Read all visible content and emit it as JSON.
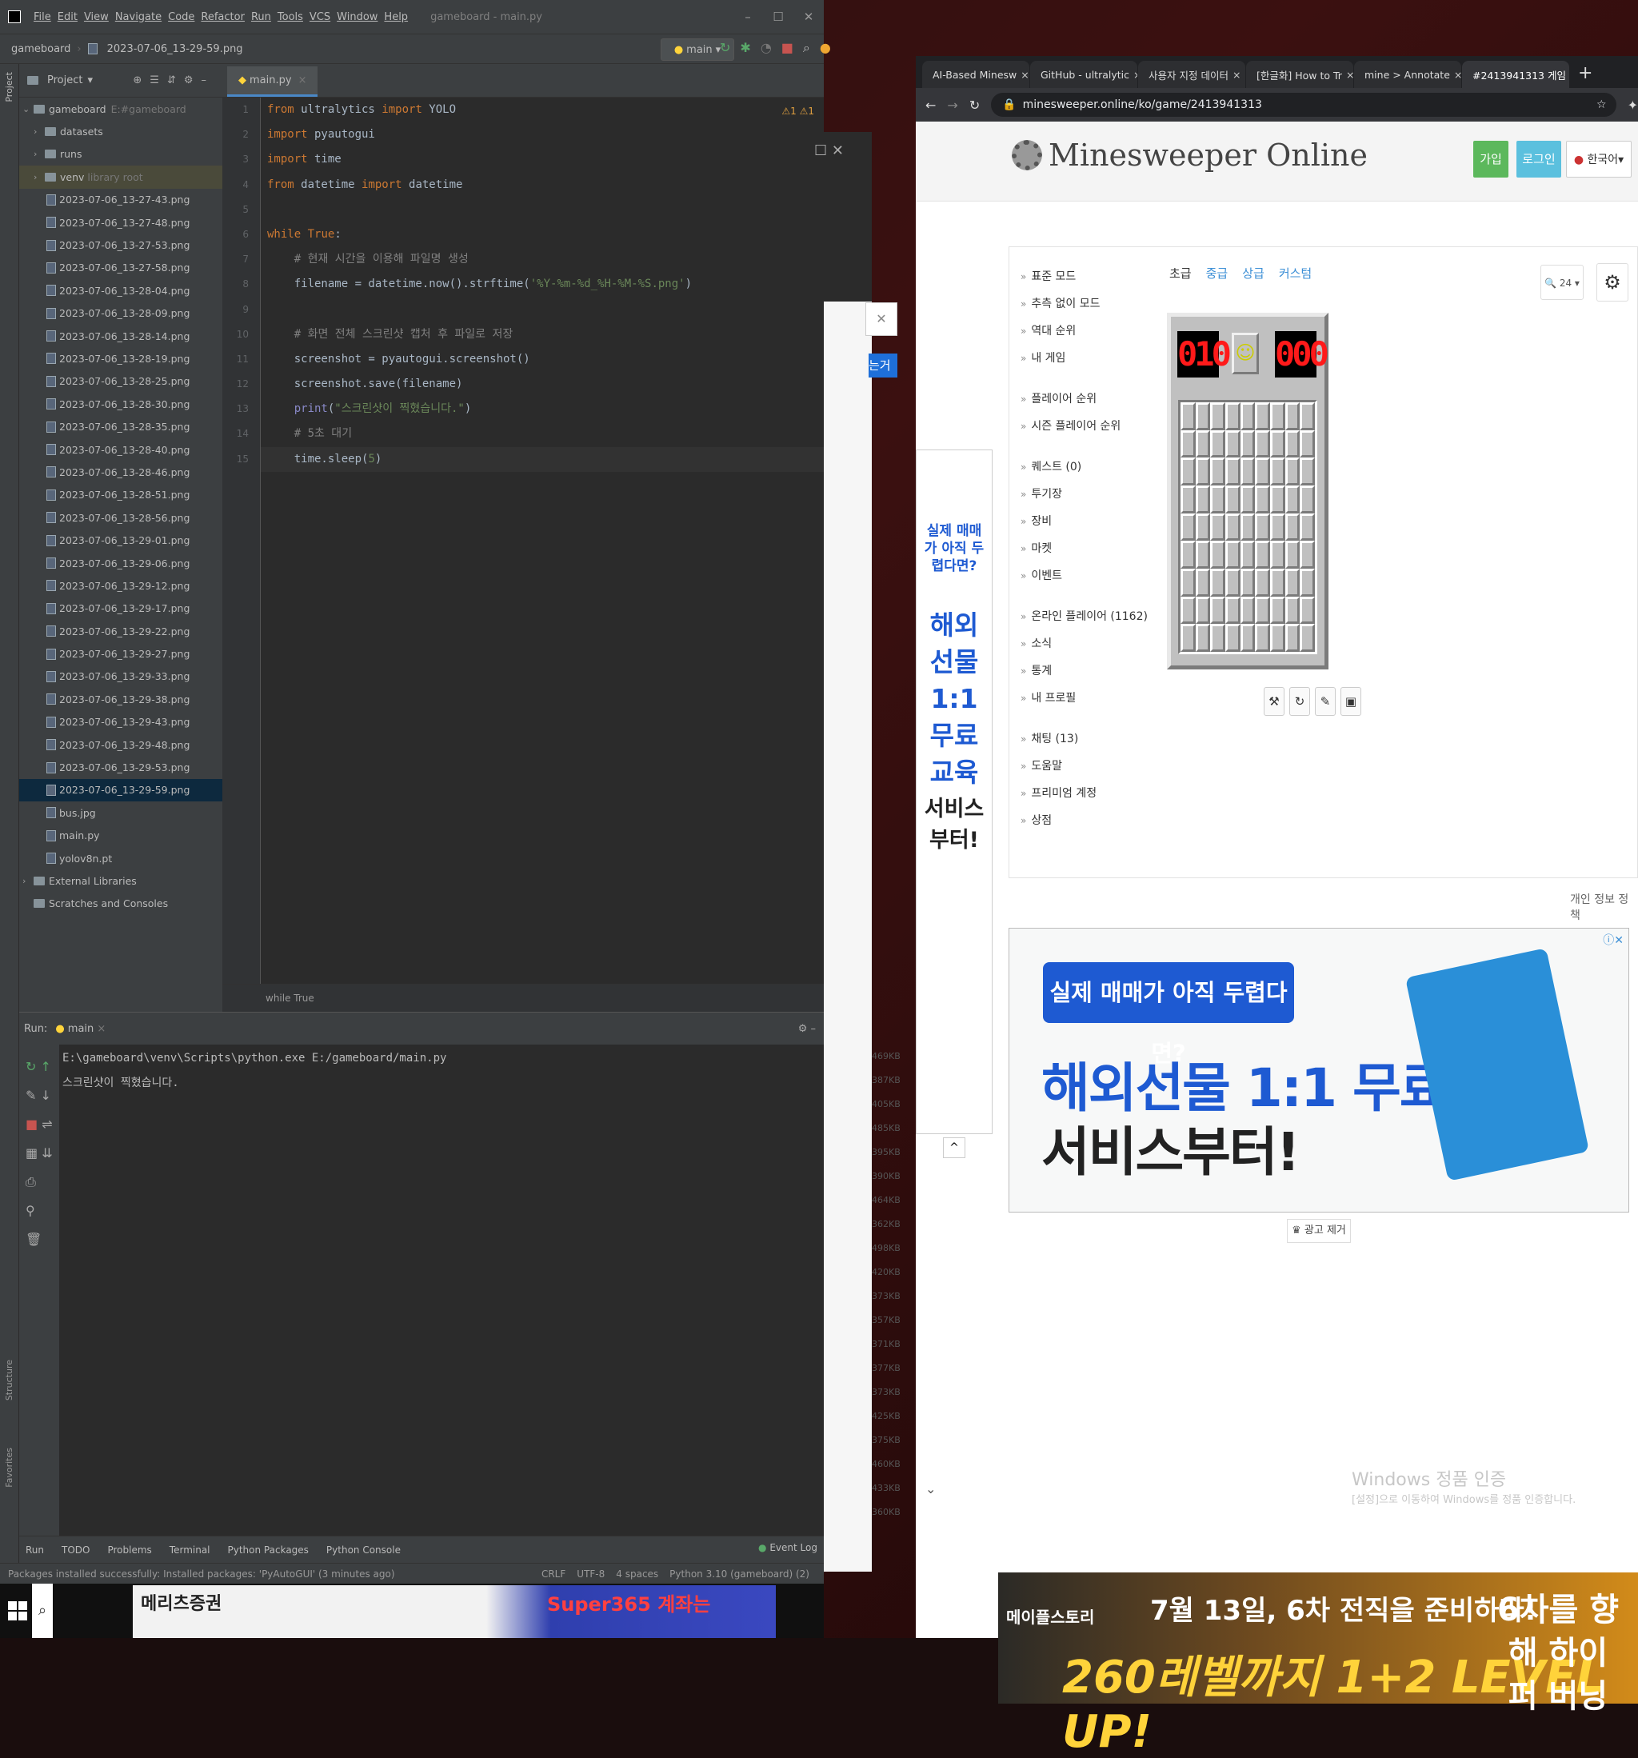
{
  "ide": {
    "menu": [
      "File",
      "Edit",
      "View",
      "Navigate",
      "Code",
      "Refactor",
      "Run",
      "Tools",
      "VCS",
      "Window",
      "Help"
    ],
    "window_title": "gameboard - main.py",
    "breadcrumb_project": "gameboard",
    "breadcrumb_file": "2023-07-06_13-29-59.png",
    "run_config": "main",
    "project_label": "Project",
    "tree_root": "gameboard",
    "tree_root_path": "E:#gameboard",
    "folders": [
      "datasets",
      "runs",
      "venv"
    ],
    "venv_note": "library root",
    "png_files": [
      "2023-07-06_13-27-43.png",
      "2023-07-06_13-27-48.png",
      "2023-07-06_13-27-53.png",
      "2023-07-06_13-27-58.png",
      "2023-07-06_13-28-04.png",
      "2023-07-06_13-28-09.png",
      "2023-07-06_13-28-14.png",
      "2023-07-06_13-28-19.png",
      "2023-07-06_13-28-25.png",
      "2023-07-06_13-28-30.png",
      "2023-07-06_13-28-35.png",
      "2023-07-06_13-28-40.png",
      "2023-07-06_13-28-46.png",
      "2023-07-06_13-28-51.png",
      "2023-07-06_13-28-56.png",
      "2023-07-06_13-29-01.png",
      "2023-07-06_13-29-06.png",
      "2023-07-06_13-29-12.png",
      "2023-07-06_13-29-17.png",
      "2023-07-06_13-29-22.png",
      "2023-07-06_13-29-27.png",
      "2023-07-06_13-29-33.png",
      "2023-07-06_13-29-38.png",
      "2023-07-06_13-29-43.png",
      "2023-07-06_13-29-48.png",
      "2023-07-06_13-29-53.png",
      "2023-07-06_13-29-59.png"
    ],
    "other_files": [
      "bus.jpg",
      "main.py",
      "yolov8n.pt"
    ],
    "external_libraries": "External Libraries",
    "scratches": "Scratches and Consoles",
    "editor_tab": "main.py",
    "inspection": "⚠1 ⚠1",
    "code_lines": [
      [
        {
          "c": "kw",
          "t": "from"
        },
        {
          "c": "",
          "t": " ultralytics "
        },
        {
          "c": "kw",
          "t": "import"
        },
        {
          "c": "",
          "t": " YOLO"
        }
      ],
      [
        {
          "c": "kw",
          "t": "import"
        },
        {
          "c": "",
          "t": " pyautogui"
        }
      ],
      [
        {
          "c": "kw",
          "t": "import"
        },
        {
          "c": "",
          "t": " time"
        }
      ],
      [
        {
          "c": "kw",
          "t": "from"
        },
        {
          "c": "",
          "t": " datetime "
        },
        {
          "c": "kw",
          "t": "import"
        },
        {
          "c": "",
          "t": " datetime"
        }
      ],
      [],
      [
        {
          "c": "kw",
          "t": "while"
        },
        {
          "c": "",
          "t": " "
        },
        {
          "c": "kw",
          "t": "True"
        },
        {
          "c": "",
          "t": ":"
        }
      ],
      [
        {
          "c": "cm",
          "t": "    # 현재 시간을 이용해 파일명 생성"
        }
      ],
      [
        {
          "c": "",
          "t": "    filename = datetime.now().strftime("
        },
        {
          "c": "st",
          "t": "'%Y-%m-%d_%H-%M-%S.png'"
        },
        {
          "c": "",
          "t": ")"
        }
      ],
      [],
      [
        {
          "c": "cm",
          "t": "    # 화면 전체 스크린샷 캡처 후 파일로 저장"
        }
      ],
      [
        {
          "c": "",
          "t": "    screenshot = pyautogui.screenshot()"
        }
      ],
      [
        {
          "c": "",
          "t": "    screenshot.save(filename)"
        }
      ],
      [
        {
          "c": "bi",
          "t": "    print"
        },
        {
          "c": "",
          "t": "("
        },
        {
          "c": "st",
          "t": "\"스크린샷이 찍혔습니다.\""
        },
        {
          "c": "",
          "t": ")"
        }
      ],
      [
        {
          "c": "cm",
          "t": "    # 5초 대기"
        }
      ],
      [
        {
          "c": "",
          "t": "    time.sleep("
        },
        {
          "c": "st",
          "t": "5"
        },
        {
          "c": "",
          "t": ")"
        }
      ]
    ],
    "code_breadcrumb": "while True",
    "run_label": "Run:",
    "run_tab": "main",
    "run_cmd": "E:\\gameboard\\venv\\Scripts\\python.exe E:/gameboard/main.py",
    "run_output": "스크린샷이 찍혔습니다.",
    "bottom_tabs": [
      "Run",
      "TODO",
      "Problems",
      "Terminal",
      "Python Packages",
      "Python Console"
    ],
    "event_log": "Event Log",
    "status_msg": "Packages installed successfully: Installed packages: 'PyAutoGUI' (3 minutes ago)",
    "status_right": [
      "CRLF",
      "UTF-8",
      "4 spaces",
      "Python 3.10 (gameboard) (2)"
    ]
  },
  "midwin": {
    "sizes": [
      "469KB",
      "387KB",
      "405KB",
      "485KB",
      "395KB",
      "390KB",
      "464KB",
      "362KB",
      "498KB",
      "420KB",
      "373KB",
      "357KB",
      "371KB",
      "377KB",
      "373KB",
      "425KB",
      "375KB",
      "460KB",
      "433KB",
      "360KB"
    ],
    "partial_text": "는거야"
  },
  "browser": {
    "tabs": [
      "AI-Based Minesw",
      "GitHub - ultralytic",
      "사용자 지정 데이터",
      "[한글화] How to Tr",
      "mine > Annotate",
      "#2413941313 게임"
    ],
    "url": "minesweeper.online/ko/game/2413941313",
    "site_name": "Minesweeper Online",
    "join": "가입",
    "login": "로그인",
    "lang": "한국어",
    "menu_groups": [
      [
        "표준 모드",
        "추측 없이 모드",
        "역대 순위",
        "내 게임"
      ],
      [
        "플레이어 순위",
        "시즌 플레이어 순위"
      ],
      [
        "퀘스트 (0)",
        "투기장",
        "장비",
        "마켓",
        "이벤트"
      ],
      [
        "온라인 플레이어 (1162)",
        "소식",
        "통계",
        "내 프로필"
      ],
      [
        "채팅 (13)",
        "도움말",
        "프리미엄 계정",
        "상점"
      ]
    ],
    "levels": [
      "초급",
      "중급",
      "상급",
      "커스텀"
    ],
    "mine_counter": "010",
    "timer": "000",
    "zoom": "24",
    "privacy": "개인 정보 정책",
    "ad_question": "실제 매매가 아직 두렵다면?",
    "ad_line1": "해외선물 1:1 무료교육",
    "ad_line2": "서비스부터!",
    "ad_side_q": "실제 매매가 아직 두렵다면?",
    "ad_side_big": "해외선물 1:1 무료교육",
    "ad_side_big2": "서비스부터!",
    "ad_remove": "광고 제거",
    "win_activation": "Windows 정품 인증",
    "win_activation_sub": "[설정]으로 이동하여 Windows를 정품 인증합니다.",
    "bottom_ad_logo": "메이플스토리",
    "bottom_ad_1": "7월 13일, 6차 전직을 준비하라!",
    "bottom_ad_2": "260레벨까지 1+2 LEVEL UP!",
    "bottom_ad_3": "6차를 향해 하이퍼 버닝"
  },
  "taskbar_ad": {
    "left_text": "메리츠증권",
    "right_text": "Super365 계좌는"
  },
  "colors": {
    "ide_bg": "#2b2b2b",
    "keyword": "#cc7832",
    "string": "#6a8759",
    "comment": "#808080",
    "accent": "#4a88c7"
  }
}
